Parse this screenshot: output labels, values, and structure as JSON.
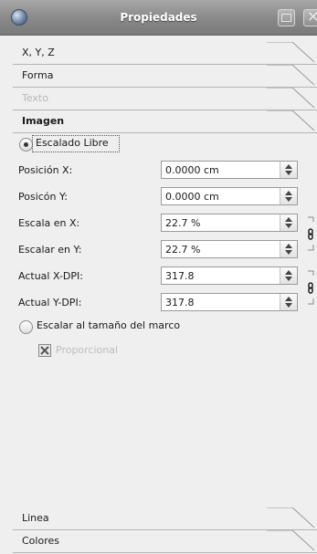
{
  "window": {
    "title": "Propiedades",
    "app_icon": "gimp-eye-icon"
  },
  "sections_top": [
    {
      "label": "X, Y, Z",
      "state": "normal"
    },
    {
      "label": "Forma",
      "state": "normal"
    },
    {
      "label": "Texto",
      "state": "disabled"
    },
    {
      "label": "Imagen",
      "state": "active"
    }
  ],
  "scaling": {
    "free_label": "Escalado Libre",
    "frame_label": "Escalar al tamaño del marco",
    "proportional_label": "Proporcional"
  },
  "fields": {
    "pos_x": {
      "label": "Posición X:",
      "value": "0.0000 cm"
    },
    "pos_y": {
      "label": "Posicón Y:",
      "value": "0.0000 cm"
    },
    "scale_x": {
      "label": "Escala en X:",
      "value": "22.7 %"
    },
    "scale_y": {
      "label": "Escalar en Y:",
      "value": "22.7 %"
    },
    "dpi_x": {
      "label": "Actual X-DPI:",
      "value": "317.8"
    },
    "dpi_y": {
      "label": "Actual Y-DPI:",
      "value": "317.8"
    }
  },
  "sections_bottom": [
    {
      "label": "Linea"
    },
    {
      "label": "Colores"
    }
  ]
}
